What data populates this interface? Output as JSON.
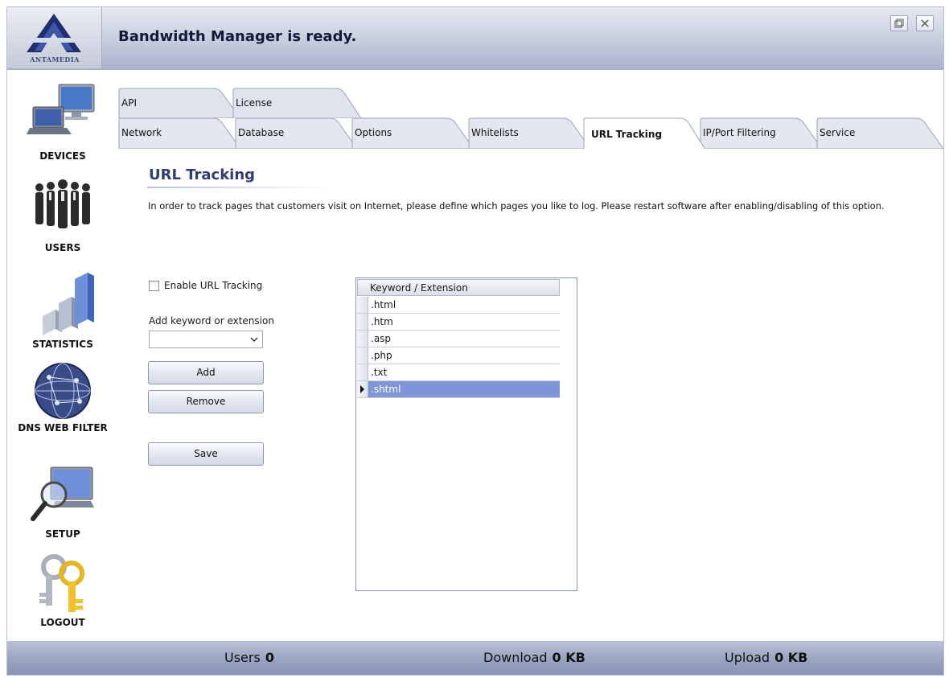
{
  "header": {
    "brand": "ANTAMEDIA",
    "status": "Bandwidth Manager is ready."
  },
  "sidebar": {
    "items": [
      {
        "label": "DEVICES",
        "icon": "devices-icon"
      },
      {
        "label": "USERS",
        "icon": "users-icon"
      },
      {
        "label": "STATISTICS",
        "icon": "statistics-icon"
      },
      {
        "label": "DNS WEB FILTER",
        "icon": "globe-icon"
      },
      {
        "label": "SETUP",
        "icon": "magnifier-icon"
      },
      {
        "label": "LOGOUT",
        "icon": "keys-icon"
      }
    ]
  },
  "tabs": {
    "back_row": [
      "API",
      "License"
    ],
    "front_row": [
      "Network",
      "Database",
      "Options",
      "Whitelists",
      "URL Tracking",
      "IP/Port Filtering",
      "Service"
    ],
    "active": "URL Tracking"
  },
  "content": {
    "title": "URL Tracking",
    "description": "In order to track pages that customers visit on Internet, please define which pages you like to log.  Please restart software after enabling/disabling of this option.",
    "enable_checkbox_label": "Enable URL Tracking",
    "enable_checked": false,
    "add_field_label": "Add keyword or extension",
    "add_field_value": "",
    "buttons": {
      "add": "Add",
      "remove": "Remove",
      "save": "Save"
    }
  },
  "grid": {
    "column_header": "Keyword / Extension",
    "rows": [
      ".html",
      ".htm",
      ".asp",
      ".php",
      ".txt",
      ".shtml"
    ],
    "selected_row": ".shtml"
  },
  "footer": {
    "users_label": "Users",
    "users_value": "0",
    "download_label": "Download",
    "download_value": "0 KB",
    "upload_label": "Upload",
    "upload_value": "0 KB"
  },
  "colors": {
    "header_gradient_top": "#e6e9f1",
    "header_gradient_bottom": "#a8b1c9",
    "selected_row": "#7e96d8",
    "title_color": "#2f3e6e"
  }
}
